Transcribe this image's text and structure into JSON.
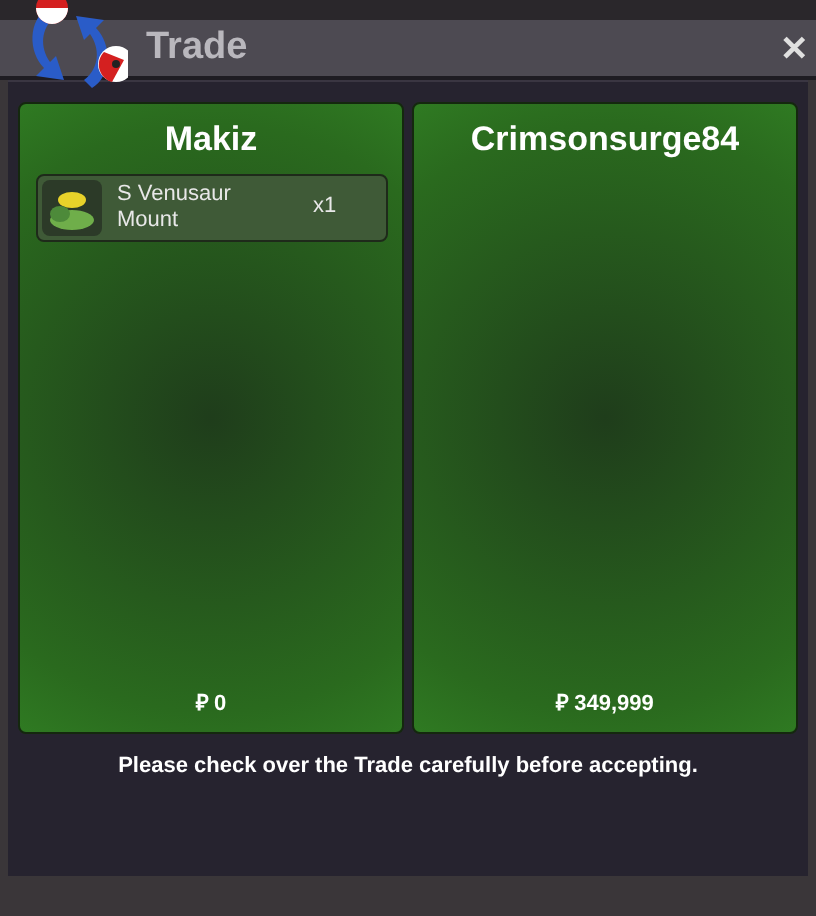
{
  "window": {
    "title": "Trade",
    "close": "✕"
  },
  "sides": [
    {
      "name": "Makiz",
      "items": [
        {
          "name": "S Venusaur Mount",
          "quantity": "x1"
        }
      ],
      "money": "₽ 0"
    },
    {
      "name": "Crimsonsurge84",
      "money": "₽ 349,999"
    }
  ],
  "notice": "Please check over the Trade carefully before accepting."
}
